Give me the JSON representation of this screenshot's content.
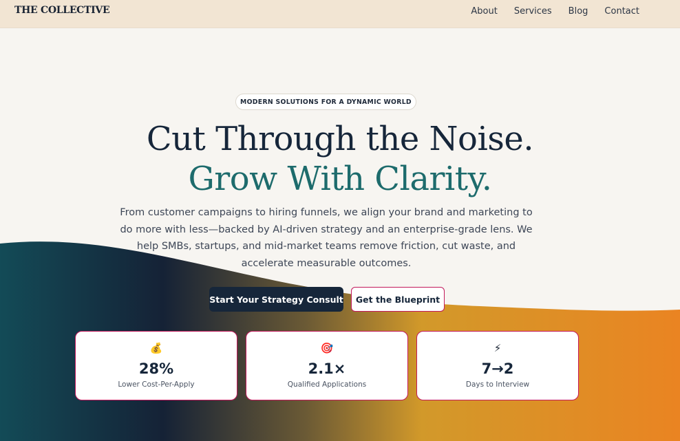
{
  "header": {
    "logo": "THE COLLECTIVE",
    "nav": [
      "About",
      "Services",
      "Blog",
      "Contact"
    ]
  },
  "hero": {
    "badge": "MODERN SOLUTIONS FOR A DYNAMIC WORLD",
    "headline_line1": "Cut Through the Noise.",
    "headline_line2": "Grow With Clarity.",
    "lede": "From customer campaigns to hiring funnels, we align your brand and marketing to do more with less—backed by AI-driven strategy and an enterprise-grade lens. We help SMBs, startups, and mid-market teams remove friction, cut waste, and accelerate measurable outcomes.",
    "primary_cta": "Start Your Strategy Consult",
    "secondary_cta": "Get the Blueprint"
  },
  "stats": [
    {
      "icon": "money-bag-icon",
      "glyph": "💰",
      "value": "28%",
      "label": "Lower Cost-Per-Apply"
    },
    {
      "icon": "target-icon",
      "glyph": "🎯",
      "value": "2.1×",
      "label": "Qualified Applications"
    },
    {
      "icon": "lightning-icon",
      "glyph": "⚡",
      "value": "7→2",
      "label": "Days to Interview"
    }
  ],
  "colors": {
    "navy": "#16263a",
    "teal": "#1d6b6c",
    "accent_border": "#c2185b",
    "header_bg": "#f2e5d3",
    "gradient": [
      "#134b57",
      "#152236",
      "#d2992a",
      "#ea8422"
    ]
  }
}
